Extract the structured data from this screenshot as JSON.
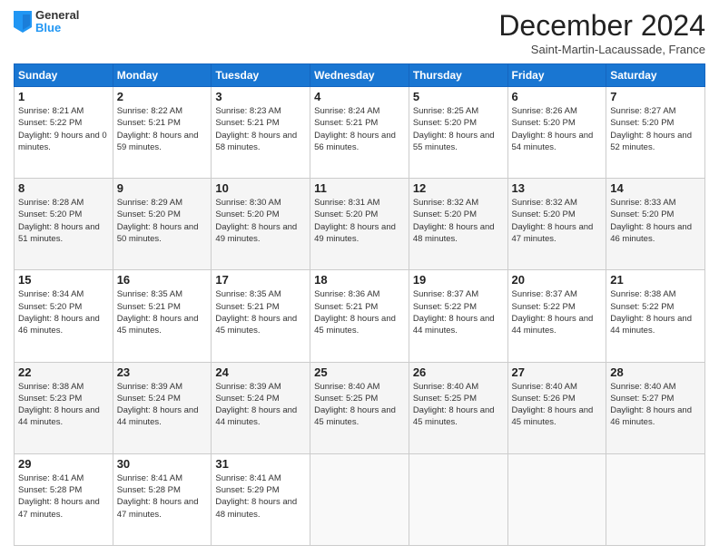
{
  "logo": {
    "general": "General",
    "blue": "Blue"
  },
  "header": {
    "month": "December 2024",
    "location": "Saint-Martin-Lacaussade, France"
  },
  "days_of_week": [
    "Sunday",
    "Monday",
    "Tuesday",
    "Wednesday",
    "Thursday",
    "Friday",
    "Saturday"
  ],
  "weeks": [
    [
      {
        "day": "1",
        "sunrise": "8:21 AM",
        "sunset": "5:22 PM",
        "daylight": "9 hours and 0 minutes."
      },
      {
        "day": "2",
        "sunrise": "8:22 AM",
        "sunset": "5:21 PM",
        "daylight": "8 hours and 59 minutes."
      },
      {
        "day": "3",
        "sunrise": "8:23 AM",
        "sunset": "5:21 PM",
        "daylight": "8 hours and 58 minutes."
      },
      {
        "day": "4",
        "sunrise": "8:24 AM",
        "sunset": "5:21 PM",
        "daylight": "8 hours and 56 minutes."
      },
      {
        "day": "5",
        "sunrise": "8:25 AM",
        "sunset": "5:20 PM",
        "daylight": "8 hours and 55 minutes."
      },
      {
        "day": "6",
        "sunrise": "8:26 AM",
        "sunset": "5:20 PM",
        "daylight": "8 hours and 54 minutes."
      },
      {
        "day": "7",
        "sunrise": "8:27 AM",
        "sunset": "5:20 PM",
        "daylight": "8 hours and 52 minutes."
      }
    ],
    [
      {
        "day": "8",
        "sunrise": "8:28 AM",
        "sunset": "5:20 PM",
        "daylight": "8 hours and 51 minutes."
      },
      {
        "day": "9",
        "sunrise": "8:29 AM",
        "sunset": "5:20 PM",
        "daylight": "8 hours and 50 minutes."
      },
      {
        "day": "10",
        "sunrise": "8:30 AM",
        "sunset": "5:20 PM",
        "daylight": "8 hours and 49 minutes."
      },
      {
        "day": "11",
        "sunrise": "8:31 AM",
        "sunset": "5:20 PM",
        "daylight": "8 hours and 49 minutes."
      },
      {
        "day": "12",
        "sunrise": "8:32 AM",
        "sunset": "5:20 PM",
        "daylight": "8 hours and 48 minutes."
      },
      {
        "day": "13",
        "sunrise": "8:32 AM",
        "sunset": "5:20 PM",
        "daylight": "8 hours and 47 minutes."
      },
      {
        "day": "14",
        "sunrise": "8:33 AM",
        "sunset": "5:20 PM",
        "daylight": "8 hours and 46 minutes."
      }
    ],
    [
      {
        "day": "15",
        "sunrise": "8:34 AM",
        "sunset": "5:20 PM",
        "daylight": "8 hours and 46 minutes."
      },
      {
        "day": "16",
        "sunrise": "8:35 AM",
        "sunset": "5:21 PM",
        "daylight": "8 hours and 45 minutes."
      },
      {
        "day": "17",
        "sunrise": "8:35 AM",
        "sunset": "5:21 PM",
        "daylight": "8 hours and 45 minutes."
      },
      {
        "day": "18",
        "sunrise": "8:36 AM",
        "sunset": "5:21 PM",
        "daylight": "8 hours and 45 minutes."
      },
      {
        "day": "19",
        "sunrise": "8:37 AM",
        "sunset": "5:22 PM",
        "daylight": "8 hours and 44 minutes."
      },
      {
        "day": "20",
        "sunrise": "8:37 AM",
        "sunset": "5:22 PM",
        "daylight": "8 hours and 44 minutes."
      },
      {
        "day": "21",
        "sunrise": "8:38 AM",
        "sunset": "5:22 PM",
        "daylight": "8 hours and 44 minutes."
      }
    ],
    [
      {
        "day": "22",
        "sunrise": "8:38 AM",
        "sunset": "5:23 PM",
        "daylight": "8 hours and 44 minutes."
      },
      {
        "day": "23",
        "sunrise": "8:39 AM",
        "sunset": "5:24 PM",
        "daylight": "8 hours and 44 minutes."
      },
      {
        "day": "24",
        "sunrise": "8:39 AM",
        "sunset": "5:24 PM",
        "daylight": "8 hours and 44 minutes."
      },
      {
        "day": "25",
        "sunrise": "8:40 AM",
        "sunset": "5:25 PM",
        "daylight": "8 hours and 45 minutes."
      },
      {
        "day": "26",
        "sunrise": "8:40 AM",
        "sunset": "5:25 PM",
        "daylight": "8 hours and 45 minutes."
      },
      {
        "day": "27",
        "sunrise": "8:40 AM",
        "sunset": "5:26 PM",
        "daylight": "8 hours and 45 minutes."
      },
      {
        "day": "28",
        "sunrise": "8:40 AM",
        "sunset": "5:27 PM",
        "daylight": "8 hours and 46 minutes."
      }
    ],
    [
      {
        "day": "29",
        "sunrise": "8:41 AM",
        "sunset": "5:28 PM",
        "daylight": "8 hours and 47 minutes."
      },
      {
        "day": "30",
        "sunrise": "8:41 AM",
        "sunset": "5:28 PM",
        "daylight": "8 hours and 47 minutes."
      },
      {
        "day": "31",
        "sunrise": "8:41 AM",
        "sunset": "5:29 PM",
        "daylight": "8 hours and 48 minutes."
      },
      null,
      null,
      null,
      null
    ]
  ],
  "labels": {
    "sunrise": "Sunrise:",
    "sunset": "Sunset:",
    "daylight": "Daylight:"
  }
}
